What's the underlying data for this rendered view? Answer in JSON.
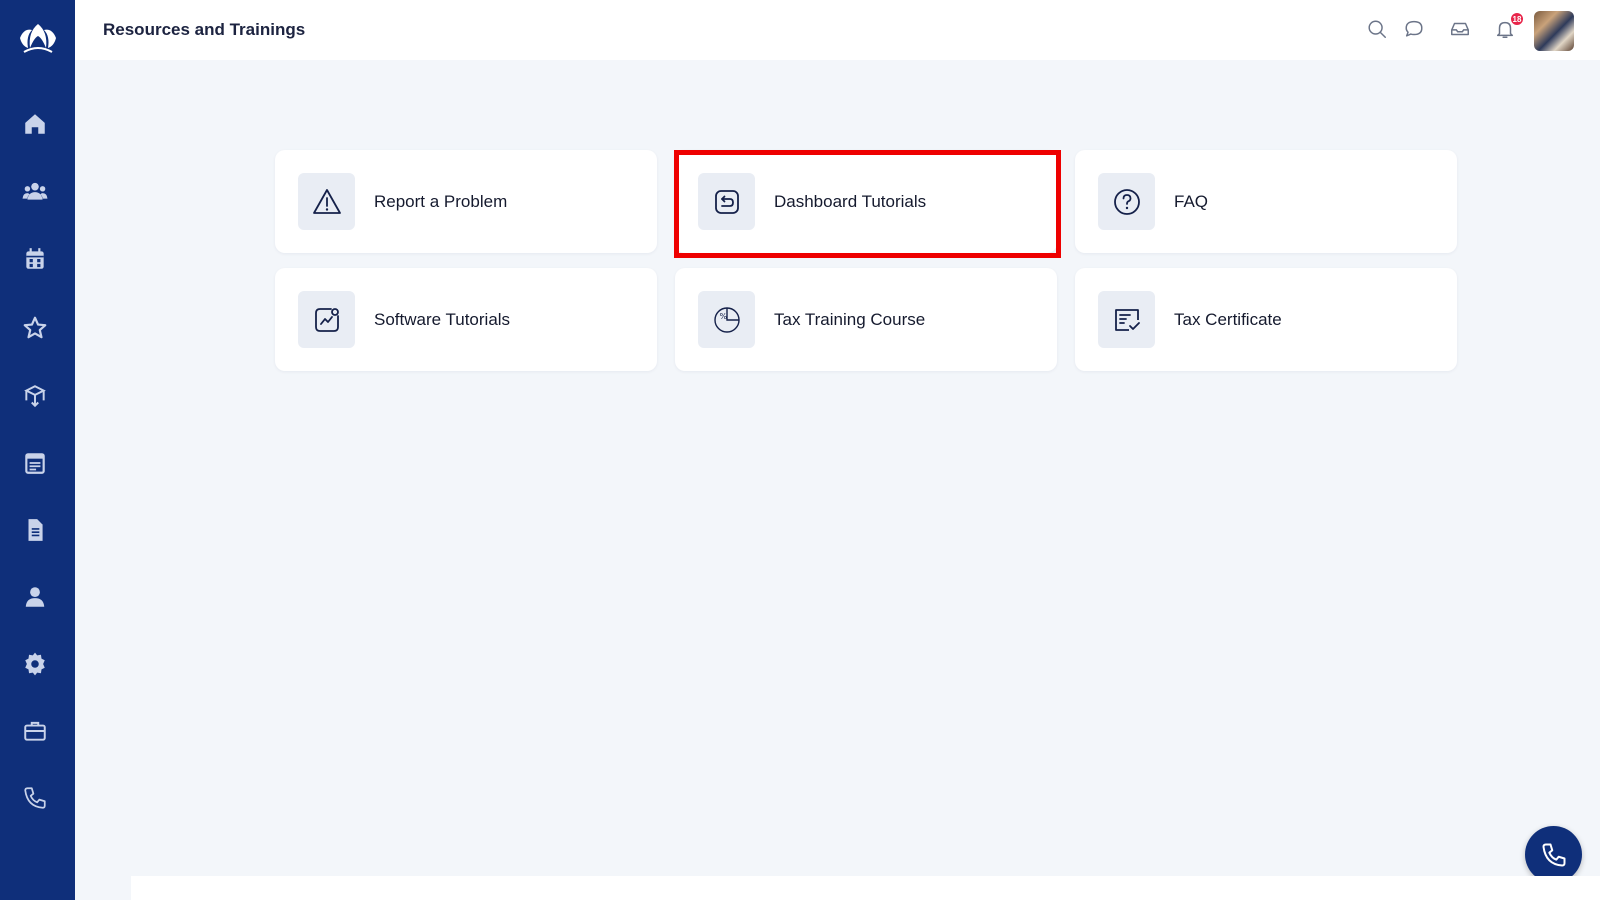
{
  "header": {
    "title": "Resources and Trainings",
    "notification_count": "18"
  },
  "sidebar": {
    "items": [
      {
        "icon": "home-icon"
      },
      {
        "icon": "users-icon"
      },
      {
        "icon": "calendar-icon"
      },
      {
        "icon": "star-icon"
      },
      {
        "icon": "box-icon"
      },
      {
        "icon": "schedule-icon"
      },
      {
        "icon": "document-icon"
      },
      {
        "icon": "user-icon"
      },
      {
        "icon": "gear-icon"
      },
      {
        "icon": "briefcase-icon"
      },
      {
        "icon": "phone-icon"
      }
    ]
  },
  "cards": [
    {
      "label": "Report a Problem",
      "icon": "warning-icon"
    },
    {
      "label": "Dashboard Tutorials",
      "icon": "return-icon"
    },
    {
      "label": "FAQ",
      "icon": "question-icon"
    },
    {
      "label": "Software Tutorials",
      "icon": "chart-icon"
    },
    {
      "label": "Tax Training Course",
      "icon": "percent-icon"
    },
    {
      "label": "Tax Certificate",
      "icon": "certificate-icon"
    }
  ],
  "colors": {
    "sidebar": "#0f2f7a",
    "highlight": "#ee0000",
    "badge": "#e8254a"
  }
}
